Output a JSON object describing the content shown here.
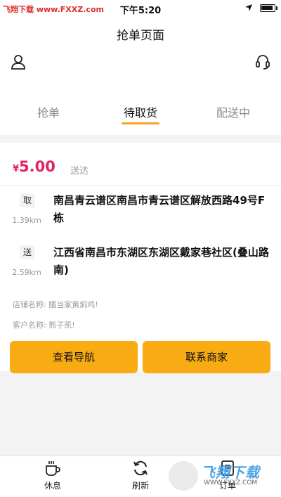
{
  "status_bar": {
    "watermark": "飞翔下载 www.FXXZ.com",
    "time": "下午5:20"
  },
  "header": {
    "title": "抢单页面"
  },
  "tabs": [
    {
      "label": "抢单",
      "active": false
    },
    {
      "label": "待取货",
      "active": true
    },
    {
      "label": "配送中",
      "active": false
    }
  ],
  "order": {
    "currency_symbol": "¥",
    "price": "5.00",
    "delivery_type": "送达",
    "pickup": {
      "badge": "取",
      "distance": "1.39km",
      "address": "南昌青云谱区南昌市青云谱区解放西路49号F栋"
    },
    "dropoff": {
      "badge": "送",
      "distance": "2.59km",
      "address": "江西省南昌市东湖区东湖区戴家巷社区(叠山路南)"
    },
    "shop_label": "店铺名称:",
    "shop_name": "膳当家黄焖鸡!",
    "customer_label": "客户名称:",
    "customer_name": "熊子凯!",
    "navigate_button": "查看导航",
    "contact_button": "联系商家"
  },
  "bottom_bar": {
    "rest_label": "休息",
    "refresh_label": "刷新",
    "orders_label": "订单"
  },
  "watermark_badge": {
    "name": "飞翔下载",
    "url": "WWW.FXXZ.COM"
  },
  "colors": {
    "accent": "#f8ab12",
    "price": "#e0245e",
    "tab_underline": "#f5a623"
  }
}
